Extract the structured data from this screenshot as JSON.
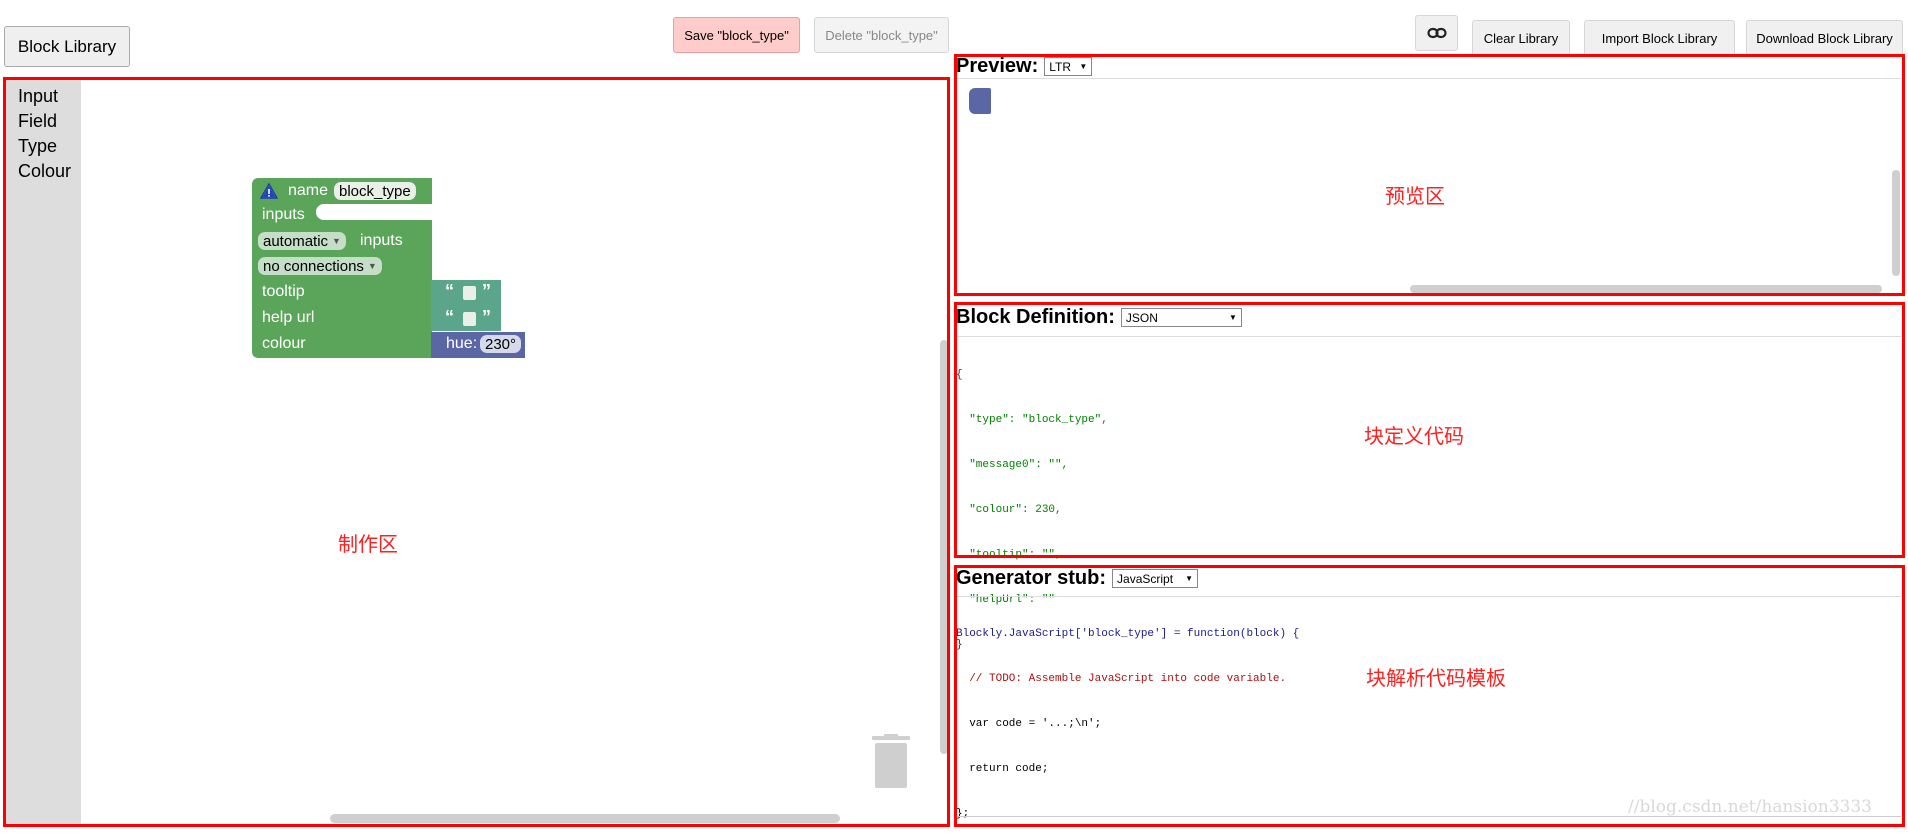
{
  "toolbar": {
    "block_library": "Block Library",
    "save": "Save \"block_type\"",
    "delete": "Delete \"block_type\"",
    "link_icon": "link-icon",
    "clear": "Clear Library",
    "import": "Import Block Library",
    "download": "Download Block Library"
  },
  "toolbox": {
    "categories": [
      "Input",
      "Field",
      "Type",
      "Colour"
    ]
  },
  "block": {
    "warning_icon": "warning-icon",
    "name_label": "name",
    "name_value": "block_type",
    "inputs_label": "inputs",
    "automatic_value": "automatic",
    "inputs_suffix": "inputs",
    "connections_value": "no connections",
    "tooltip_label": "tooltip",
    "helpurl_label": "help url",
    "colour_label": "colour",
    "quote_open": "“",
    "quote_close": "”",
    "hue_label": "hue:",
    "hue_value": "230°"
  },
  "preview": {
    "title": "Preview:",
    "direction": "LTR",
    "annotation": "预览区"
  },
  "definition": {
    "title": "Block Definition:",
    "format": "JSON",
    "annotation": "块定义代码",
    "code_lines": [
      "{",
      "  \"type\": \"block_type\",",
      "  \"message0\": \"\",",
      "  \"colour\": 230,",
      "  \"tooltip\": \"\",",
      "  \"helpUrl\": \"\"",
      "}"
    ]
  },
  "generator": {
    "title": "Generator stub:",
    "language": "JavaScript",
    "annotation": "块解析代码模板",
    "code_lines": [
      "Blockly.JavaScript['block_type'] = function(block) {",
      "  // TODO: Assemble JavaScript into code variable.",
      "  var code = '...;\\n';",
      "  return code;",
      "};"
    ]
  },
  "workspace": {
    "annotation": "制作区",
    "trash_icon": "trash-icon"
  },
  "watermark": "//blog.csdn.net/hansion3333",
  "colors": {
    "annotation_red": "#ff0000",
    "block_green": "#5ba55b",
    "hue_blue": "#5b67a5",
    "save_bg": "#ffcccc"
  }
}
